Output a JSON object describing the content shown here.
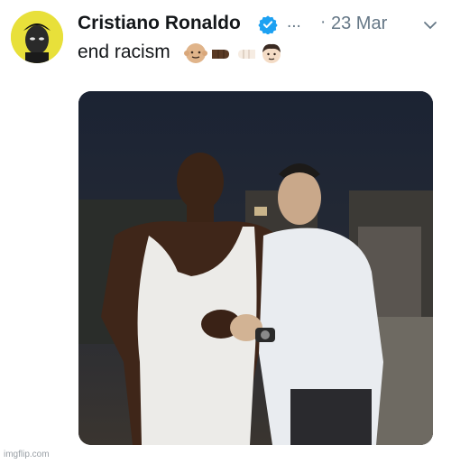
{
  "tweet": {
    "author_name": "Cristiano Ronaldo",
    "more_label": "...",
    "separator": "·",
    "date": "23 Mar",
    "text": "end racism",
    "emojis": [
      "light-skin-face-emoji",
      "dark-fist-emoji",
      "light-fist-emoji",
      "light-skin-boy-emoji"
    ],
    "icons": {
      "verified": "verified-badge-icon",
      "chevron": "chevron-down-icon"
    },
    "colors": {
      "verified_blue": "#1da1f2",
      "text": "#14171a",
      "muted": "#657786",
      "avatar_bg": "#e8e03a"
    }
  },
  "watermark": {
    "text": "imgflip.com"
  }
}
